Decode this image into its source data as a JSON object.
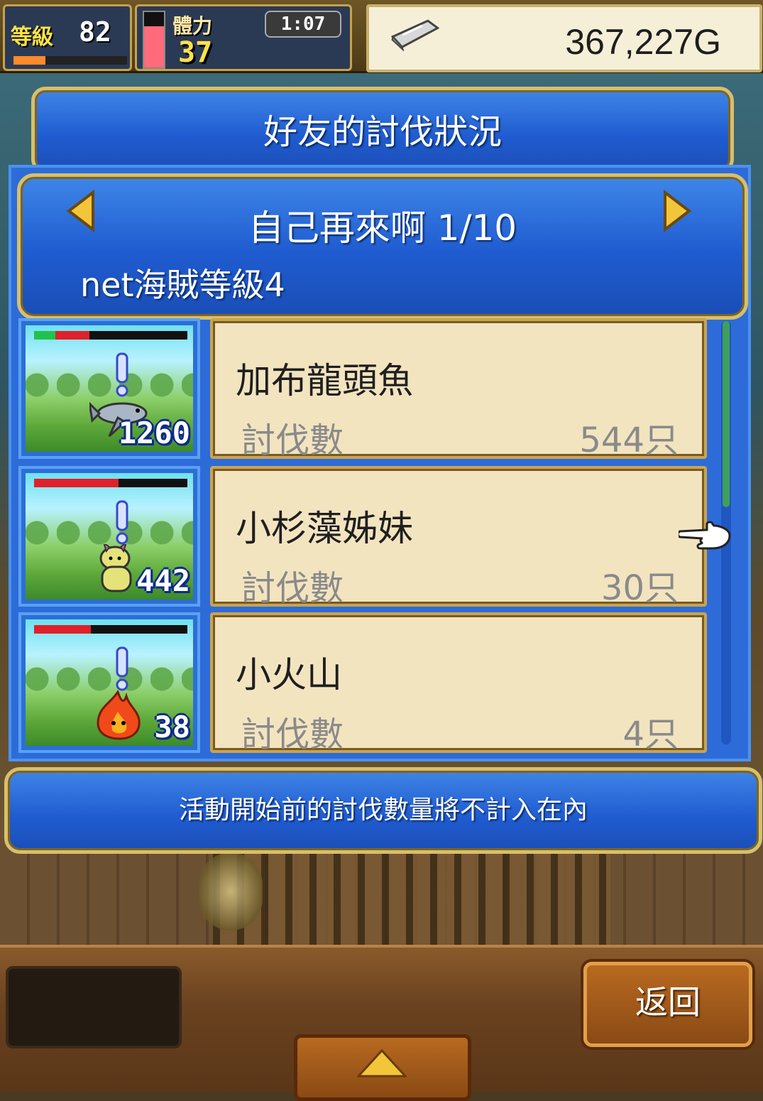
{
  "hud": {
    "level_label": "等級",
    "level_value": "82",
    "exp_fraction": 0.28,
    "stamina_label": "體力",
    "stamina_value": "37",
    "stamina_fraction": 0.75,
    "timer": "1:07",
    "gold_icon": "silver-bar-icon",
    "gold_value": "367,227G"
  },
  "panel": {
    "title": "好友的討伐狀況",
    "friend_name": "自己再來啊 1/10",
    "friend_rank": "net海賊等級4",
    "prev_icon": "arrow-left-icon",
    "next_icon": "arrow-right-icon"
  },
  "monsters": [
    {
      "name": "加布龍頭魚",
      "label": "討伐數",
      "count": "544只",
      "badge": "1260",
      "hp_green": 0.14,
      "hp_red": 0.22,
      "icon": "fish-icon"
    },
    {
      "name": "小杉藻姊妹",
      "label": "討伐數",
      "count": "30只",
      "badge": "442",
      "hp_green": 0.0,
      "hp_red": 0.55,
      "icon": "seaweed-sister-icon"
    },
    {
      "name": "小火山",
      "label": "討伐數",
      "count": "4只",
      "badge": "38",
      "hp_green": 0.0,
      "hp_red": 0.37,
      "icon": "fire-monster-icon"
    }
  ],
  "note": "活動開始前的討伐數量將不計入在內",
  "bottom": {
    "back_label": "返回",
    "expand_icon": "triangle-up-icon"
  },
  "colors": {
    "panel_blue": "#1f5bd0",
    "card_bg": "#f3e4c0",
    "hp_red": "#e0202a",
    "hp_green": "#22c24a",
    "gold_text": "#ffe24a"
  }
}
